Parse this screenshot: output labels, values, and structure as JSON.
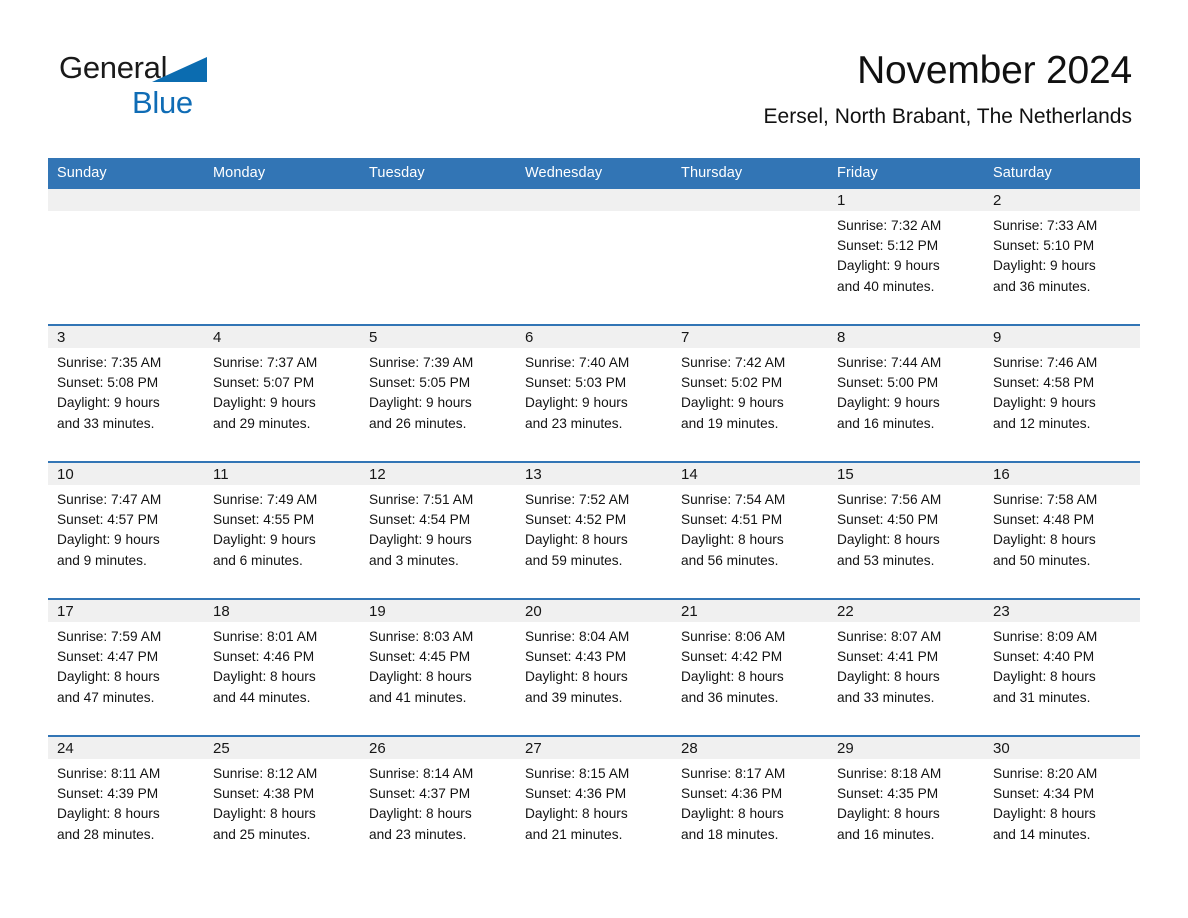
{
  "brand": {
    "word1": "General",
    "word2": "Blue",
    "triangle_color": "#0b6cb0",
    "accent_color": "#0f6cb5",
    "logo_icon": "blue-triangle-icon"
  },
  "header": {
    "title": "November 2024",
    "location": "Eersel, North Brabant, The Netherlands"
  },
  "theme": {
    "header_blue": "#3275b5",
    "daynum_band": "#f0f0f0",
    "row_divider": "#3275b5",
    "page_background": "#ffffff"
  },
  "calendar": {
    "weekday_headers": [
      "Sunday",
      "Monday",
      "Tuesday",
      "Wednesday",
      "Thursday",
      "Friday",
      "Saturday"
    ],
    "labels": {
      "sunrise": "Sunrise:",
      "sunset": "Sunset:",
      "daylight": "Daylight:"
    },
    "weeks": [
      [
        {
          "day": ""
        },
        {
          "day": ""
        },
        {
          "day": ""
        },
        {
          "day": ""
        },
        {
          "day": ""
        },
        {
          "day": "1",
          "sunrise": "Sunrise: 7:32 AM",
          "sunset": "Sunset: 5:12 PM",
          "daylight_l1": "Daylight: 9 hours",
          "daylight_l2": "and 40 minutes."
        },
        {
          "day": "2",
          "sunrise": "Sunrise: 7:33 AM",
          "sunset": "Sunset: 5:10 PM",
          "daylight_l1": "Daylight: 9 hours",
          "daylight_l2": "and 36 minutes."
        }
      ],
      [
        {
          "day": "3",
          "sunrise": "Sunrise: 7:35 AM",
          "sunset": "Sunset: 5:08 PM",
          "daylight_l1": "Daylight: 9 hours",
          "daylight_l2": "and 33 minutes."
        },
        {
          "day": "4",
          "sunrise": "Sunrise: 7:37 AM",
          "sunset": "Sunset: 5:07 PM",
          "daylight_l1": "Daylight: 9 hours",
          "daylight_l2": "and 29 minutes."
        },
        {
          "day": "5",
          "sunrise": "Sunrise: 7:39 AM",
          "sunset": "Sunset: 5:05 PM",
          "daylight_l1": "Daylight: 9 hours",
          "daylight_l2": "and 26 minutes."
        },
        {
          "day": "6",
          "sunrise": "Sunrise: 7:40 AM",
          "sunset": "Sunset: 5:03 PM",
          "daylight_l1": "Daylight: 9 hours",
          "daylight_l2": "and 23 minutes."
        },
        {
          "day": "7",
          "sunrise": "Sunrise: 7:42 AM",
          "sunset": "Sunset: 5:02 PM",
          "daylight_l1": "Daylight: 9 hours",
          "daylight_l2": "and 19 minutes."
        },
        {
          "day": "8",
          "sunrise": "Sunrise: 7:44 AM",
          "sunset": "Sunset: 5:00 PM",
          "daylight_l1": "Daylight: 9 hours",
          "daylight_l2": "and 16 minutes."
        },
        {
          "day": "9",
          "sunrise": "Sunrise: 7:46 AM",
          "sunset": "Sunset: 4:58 PM",
          "daylight_l1": "Daylight: 9 hours",
          "daylight_l2": "and 12 minutes."
        }
      ],
      [
        {
          "day": "10",
          "sunrise": "Sunrise: 7:47 AM",
          "sunset": "Sunset: 4:57 PM",
          "daylight_l1": "Daylight: 9 hours",
          "daylight_l2": "and 9 minutes."
        },
        {
          "day": "11",
          "sunrise": "Sunrise: 7:49 AM",
          "sunset": "Sunset: 4:55 PM",
          "daylight_l1": "Daylight: 9 hours",
          "daylight_l2": "and 6 minutes."
        },
        {
          "day": "12",
          "sunrise": "Sunrise: 7:51 AM",
          "sunset": "Sunset: 4:54 PM",
          "daylight_l1": "Daylight: 9 hours",
          "daylight_l2": "and 3 minutes."
        },
        {
          "day": "13",
          "sunrise": "Sunrise: 7:52 AM",
          "sunset": "Sunset: 4:52 PM",
          "daylight_l1": "Daylight: 8 hours",
          "daylight_l2": "and 59 minutes."
        },
        {
          "day": "14",
          "sunrise": "Sunrise: 7:54 AM",
          "sunset": "Sunset: 4:51 PM",
          "daylight_l1": "Daylight: 8 hours",
          "daylight_l2": "and 56 minutes."
        },
        {
          "day": "15",
          "sunrise": "Sunrise: 7:56 AM",
          "sunset": "Sunset: 4:50 PM",
          "daylight_l1": "Daylight: 8 hours",
          "daylight_l2": "and 53 minutes."
        },
        {
          "day": "16",
          "sunrise": "Sunrise: 7:58 AM",
          "sunset": "Sunset: 4:48 PM",
          "daylight_l1": "Daylight: 8 hours",
          "daylight_l2": "and 50 minutes."
        }
      ],
      [
        {
          "day": "17",
          "sunrise": "Sunrise: 7:59 AM",
          "sunset": "Sunset: 4:47 PM",
          "daylight_l1": "Daylight: 8 hours",
          "daylight_l2": "and 47 minutes."
        },
        {
          "day": "18",
          "sunrise": "Sunrise: 8:01 AM",
          "sunset": "Sunset: 4:46 PM",
          "daylight_l1": "Daylight: 8 hours",
          "daylight_l2": "and 44 minutes."
        },
        {
          "day": "19",
          "sunrise": "Sunrise: 8:03 AM",
          "sunset": "Sunset: 4:45 PM",
          "daylight_l1": "Daylight: 8 hours",
          "daylight_l2": "and 41 minutes."
        },
        {
          "day": "20",
          "sunrise": "Sunrise: 8:04 AM",
          "sunset": "Sunset: 4:43 PM",
          "daylight_l1": "Daylight: 8 hours",
          "daylight_l2": "and 39 minutes."
        },
        {
          "day": "21",
          "sunrise": "Sunrise: 8:06 AM",
          "sunset": "Sunset: 4:42 PM",
          "daylight_l1": "Daylight: 8 hours",
          "daylight_l2": "and 36 minutes."
        },
        {
          "day": "22",
          "sunrise": "Sunrise: 8:07 AM",
          "sunset": "Sunset: 4:41 PM",
          "daylight_l1": "Daylight: 8 hours",
          "daylight_l2": "and 33 minutes."
        },
        {
          "day": "23",
          "sunrise": "Sunrise: 8:09 AM",
          "sunset": "Sunset: 4:40 PM",
          "daylight_l1": "Daylight: 8 hours",
          "daylight_l2": "and 31 minutes."
        }
      ],
      [
        {
          "day": "24",
          "sunrise": "Sunrise: 8:11 AM",
          "sunset": "Sunset: 4:39 PM",
          "daylight_l1": "Daylight: 8 hours",
          "daylight_l2": "and 28 minutes."
        },
        {
          "day": "25",
          "sunrise": "Sunrise: 8:12 AM",
          "sunset": "Sunset: 4:38 PM",
          "daylight_l1": "Daylight: 8 hours",
          "daylight_l2": "and 25 minutes."
        },
        {
          "day": "26",
          "sunrise": "Sunrise: 8:14 AM",
          "sunset": "Sunset: 4:37 PM",
          "daylight_l1": "Daylight: 8 hours",
          "daylight_l2": "and 23 minutes."
        },
        {
          "day": "27",
          "sunrise": "Sunrise: 8:15 AM",
          "sunset": "Sunset: 4:36 PM",
          "daylight_l1": "Daylight: 8 hours",
          "daylight_l2": "and 21 minutes."
        },
        {
          "day": "28",
          "sunrise": "Sunrise: 8:17 AM",
          "sunset": "Sunset: 4:36 PM",
          "daylight_l1": "Daylight: 8 hours",
          "daylight_l2": "and 18 minutes."
        },
        {
          "day": "29",
          "sunrise": "Sunrise: 8:18 AM",
          "sunset": "Sunset: 4:35 PM",
          "daylight_l1": "Daylight: 8 hours",
          "daylight_l2": "and 16 minutes."
        },
        {
          "day": "30",
          "sunrise": "Sunrise: 8:20 AM",
          "sunset": "Sunset: 4:34 PM",
          "daylight_l1": "Daylight: 8 hours",
          "daylight_l2": "and 14 minutes."
        }
      ]
    ]
  }
}
